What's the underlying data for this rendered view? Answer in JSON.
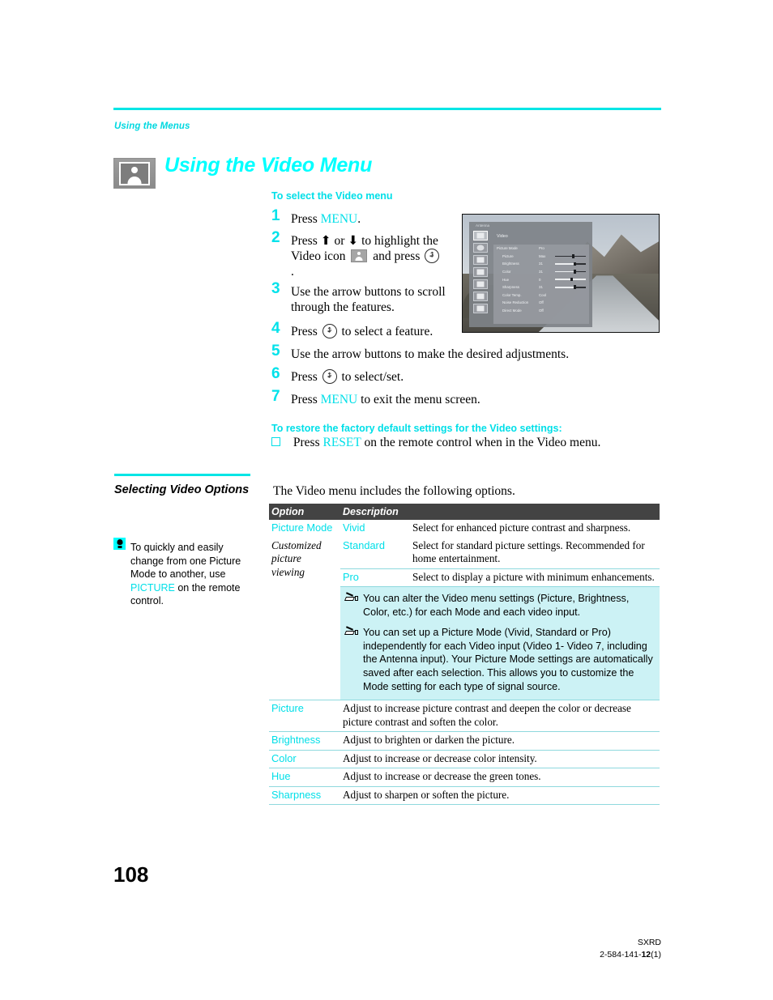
{
  "header": {
    "running_head": "Using the Menus",
    "chapter_title": "Using the Video Menu",
    "chapter_icon": "video-person-frame-icon"
  },
  "procedure": {
    "subhead": "To select the Video menu",
    "steps": [
      {
        "num": "1",
        "pre": "Press ",
        "kw": "MENU",
        "post": "."
      },
      {
        "num": "2",
        "pre": "Press ⬆ or ⬇ to highlight the Video icon ",
        "post": " and press ",
        "tail": " ."
      },
      {
        "num": "3",
        "pre": "Use the arrow buttons to scroll through the features.",
        "post": ""
      },
      {
        "num": "4",
        "pre": "Press ",
        "post": " to select a feature."
      },
      {
        "num": "5",
        "pre": "Use the arrow buttons to make the desired adjustments.",
        "post": ""
      },
      {
        "num": "6",
        "pre": "Press ",
        "post": " to select/set."
      },
      {
        "num": "7",
        "pre": "Press ",
        "kw": "MENU",
        "post": " to exit the menu screen."
      }
    ]
  },
  "restore": {
    "subhead": "To restore the factory default settings for the Video settings:",
    "pre": "Press ",
    "kw": "RESET",
    "post": " on the remote control when in the Video menu."
  },
  "tv_screenshot": {
    "osd_title": "Antenna",
    "osd_menu_name": "Video",
    "rows": [
      {
        "label": "Picture Mode",
        "value": "Pro",
        "bar": null
      },
      {
        "label": "Picture",
        "value": "Max",
        "bar": 55
      },
      {
        "label": "Brightness",
        "value": "31",
        "bar": 60
      },
      {
        "label": "Color",
        "value": "31",
        "bar": 60
      },
      {
        "label": "Hue",
        "value": "0",
        "bar": 50
      },
      {
        "label": "Sharpness",
        "value": "31",
        "bar": 60
      },
      {
        "label": "Color Temp.",
        "value": "Cool",
        "bar": null
      },
      {
        "label": "Noise Reduction",
        "value": "Off",
        "bar": null
      },
      {
        "label": "Direct Mode",
        "value": "Off",
        "bar": null
      }
    ]
  },
  "left_column": {
    "heading": "Selecting Video Options",
    "tip_icon": "lightbulb-tip-icon",
    "tip_pre": "To quickly and easily change from one Picture Mode to another, use ",
    "tip_kw": "PICTURE",
    "tip_post": " on the remote control."
  },
  "table": {
    "intro": "The Video menu includes the following options.",
    "headers": {
      "option": "Option",
      "description": "Description"
    },
    "picture_mode": {
      "option": "Picture Mode",
      "sub_lines": [
        "Customized",
        "picture",
        "viewing"
      ],
      "values": [
        {
          "name": "Vivid",
          "desc": "Select for enhanced picture contrast and sharpness."
        },
        {
          "name": "Standard",
          "desc": "Select for standard picture settings. Recommended for home entertainment."
        },
        {
          "name": "Pro",
          "desc": "Select to display a picture with minimum enhancements."
        }
      ]
    },
    "notes": [
      "You can alter the Video menu settings (Picture, Brightness, Color, etc.) for each Mode and each video input.",
      "You can set up a Picture Mode (Vivid, Standard or Pro) independently for each Video input (Video 1- Video 7, including the Antenna input). Your Picture Mode settings are automatically saved after each selection. This allows you to customize the Mode setting for each type of signal source."
    ],
    "rows": [
      {
        "option": "Picture",
        "desc": "Adjust to increase picture contrast and deepen the color or decrease picture contrast and soften the color."
      },
      {
        "option": "Brightness",
        "desc": "Adjust to brighten or darken the picture."
      },
      {
        "option": "Color",
        "desc": "Adjust to increase or decrease color intensity."
      },
      {
        "option": "Hue",
        "desc": "Adjust to increase or decrease the green tones."
      },
      {
        "option": "Sharpness",
        "desc": "Adjust to sharpen or soften the picture."
      }
    ]
  },
  "footer": {
    "page_number": "108",
    "model": "SXRD",
    "doc_prefix": "2-584-141-",
    "doc_bold": "12",
    "doc_suffix": "(1)"
  },
  "colors": {
    "accent": "#00ffff",
    "accent_text": "#00dfe8",
    "note_bg": "#ccf2f5",
    "table_header_bg": "#434343"
  }
}
